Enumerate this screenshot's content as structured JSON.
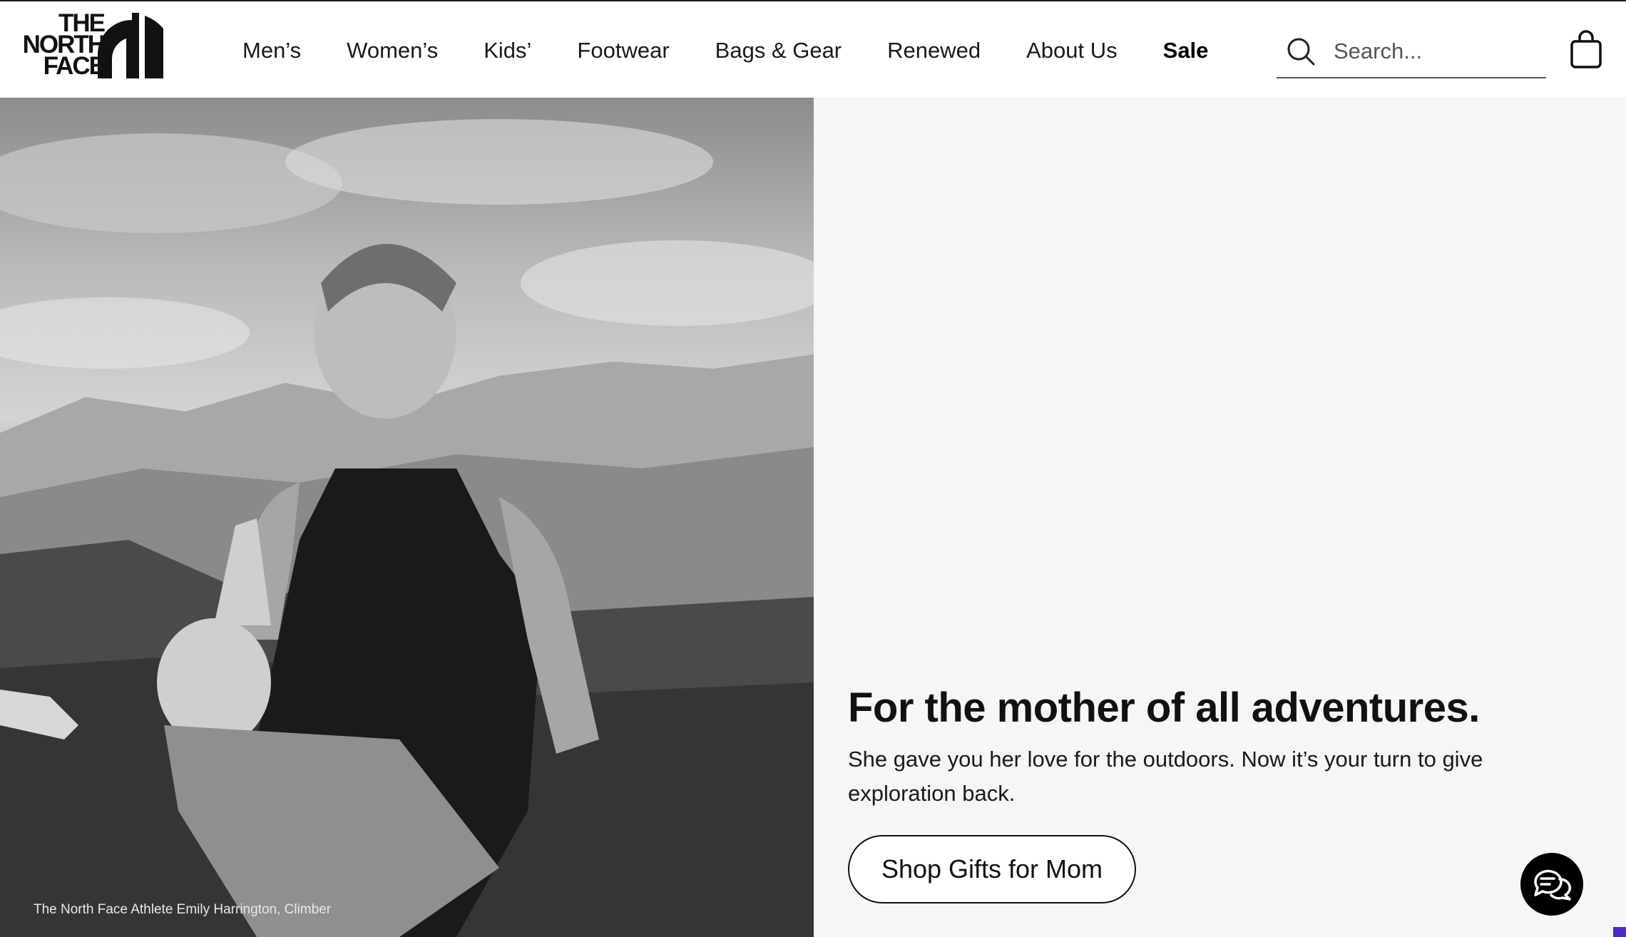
{
  "brand": {
    "logo_lines": [
      "THE",
      "NORTH",
      "FACE"
    ]
  },
  "nav": {
    "items": [
      {
        "label": "Men’s",
        "name": "nav-mens"
      },
      {
        "label": "Women’s",
        "name": "nav-womens"
      },
      {
        "label": "Kids’",
        "name": "nav-kids"
      },
      {
        "label": "Footwear",
        "name": "nav-footwear"
      },
      {
        "label": "Bags & Gear",
        "name": "nav-bags-gear"
      },
      {
        "label": "Renewed",
        "name": "nav-renewed"
      },
      {
        "label": "About Us",
        "name": "nav-about-us"
      },
      {
        "label": "Sale",
        "name": "nav-sale"
      }
    ]
  },
  "search": {
    "placeholder": "Search...",
    "value": "",
    "icon": "search-icon"
  },
  "cart": {
    "icon": "shopping-bag-icon"
  },
  "hero": {
    "photo_caption": "The North Face Athlete Emily Harrington, Climber",
    "title": "For the mother of all adventures.",
    "body": "She gave you her love for the outdoors. Now it’s your turn to give exploration back.",
    "cta_label": "Shop Gifts for Mom"
  },
  "chat": {
    "icon": "chat-bubbles-icon"
  },
  "colors": {
    "text": "#111111",
    "panel_bg": "#f6f6f6",
    "accent": "#4b2ac8"
  }
}
